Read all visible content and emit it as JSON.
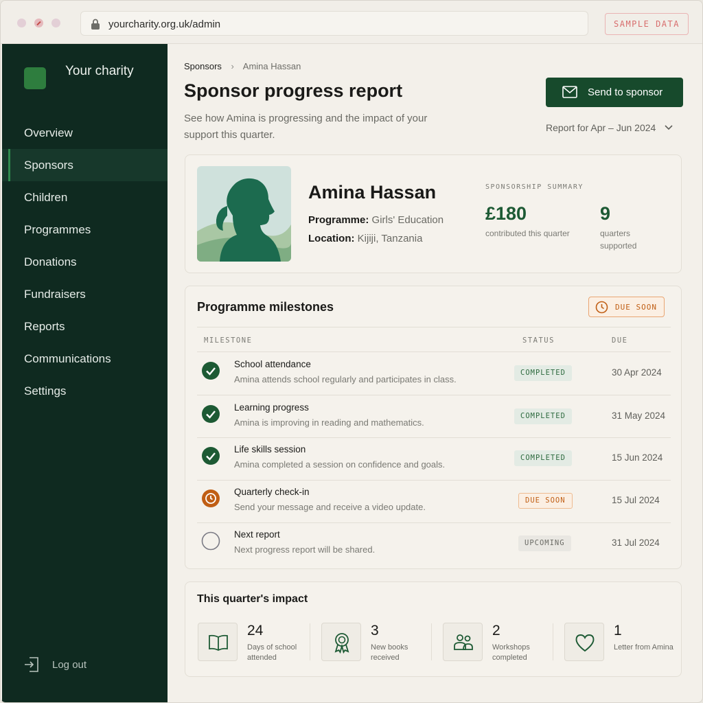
{
  "browser": {
    "url": "yourcharity.org.uk/admin",
    "sample_label": "SAMPLE DATA"
  },
  "sidebar": {
    "logo_text": "Your charity",
    "items": [
      {
        "label": "Overview"
      },
      {
        "label": "Sponsors"
      },
      {
        "label": "Children"
      },
      {
        "label": "Programmes"
      },
      {
        "label": "Donations"
      },
      {
        "label": "Fundraisers"
      },
      {
        "label": "Reports"
      },
      {
        "label": "Communications"
      },
      {
        "label": "Settings"
      }
    ],
    "active_item": "Sponsors",
    "logout_label": "Log out"
  },
  "breadcrumb": {
    "parent": "Sponsors",
    "current": "Amina Hassan"
  },
  "header": {
    "title": "Sponsor progress report",
    "subtitle": "See how Amina is progressing and the impact of your support this quarter.",
    "send_button": "Send to sponsor",
    "period": "Report for Apr – Jun 2024"
  },
  "profile": {
    "name": "Amina Hassan",
    "programme_label": "Programme:",
    "programme": "Girls' Education",
    "location_label": "Location:",
    "location": "Kijiji, Tanzania",
    "summary_title": "SPONSORSHIP SUMMARY",
    "contribution_value": "£180",
    "contribution_label": "contributed this quarter",
    "quarters_value": "9",
    "quarters_label": "quarters supported"
  },
  "milestones": {
    "title": "Programme milestones",
    "chip": "DUE SOON",
    "columns": {
      "milestone": "MILESTONE",
      "status": "STATUS",
      "due": "DUE"
    },
    "rows": [
      {
        "title": "School attendance",
        "desc": "Amina attends school regularly and participates in class.",
        "status": "COMPLETED",
        "due": "30 Apr 2024",
        "icon": "check-circle-icon"
      },
      {
        "title": "Learning progress",
        "desc": "Amina is improving in reading and mathematics.",
        "status": "COMPLETED",
        "due": "31 May 2024",
        "icon": "check-circle-icon"
      },
      {
        "title": "Life skills session",
        "desc": "Amina completed a session on confidence and goals.",
        "status": "COMPLETED",
        "due": "15 Jun 2024",
        "icon": "check-circle-icon"
      },
      {
        "title": "Quarterly check-in",
        "desc": "Send your message and receive a video update.",
        "status": "DUE SOON",
        "due": "15 Jul 2024",
        "icon": "clock-icon"
      },
      {
        "title": "Next report",
        "desc": "Next progress report will be shared.",
        "status": "UPCOMING",
        "due": "31 Jul 2024",
        "icon": "empty-circle-icon"
      }
    ]
  },
  "impact": {
    "title": "This quarter's impact",
    "items": [
      {
        "value": "24",
        "label": "Days of school attended",
        "icon": "book-icon"
      },
      {
        "value": "3",
        "label": "New books received",
        "icon": "award-icon"
      },
      {
        "value": "2",
        "label": "Workshops completed",
        "icon": "people-icon"
      },
      {
        "value": "1",
        "label": "Letter from Amina",
        "icon": "heart-icon"
      }
    ]
  },
  "colors": {
    "sidebar_bg": "#0f2a20",
    "accent_green": "#174a2c",
    "completed_green": "#1d5a34",
    "due_orange": "#c05e14"
  }
}
